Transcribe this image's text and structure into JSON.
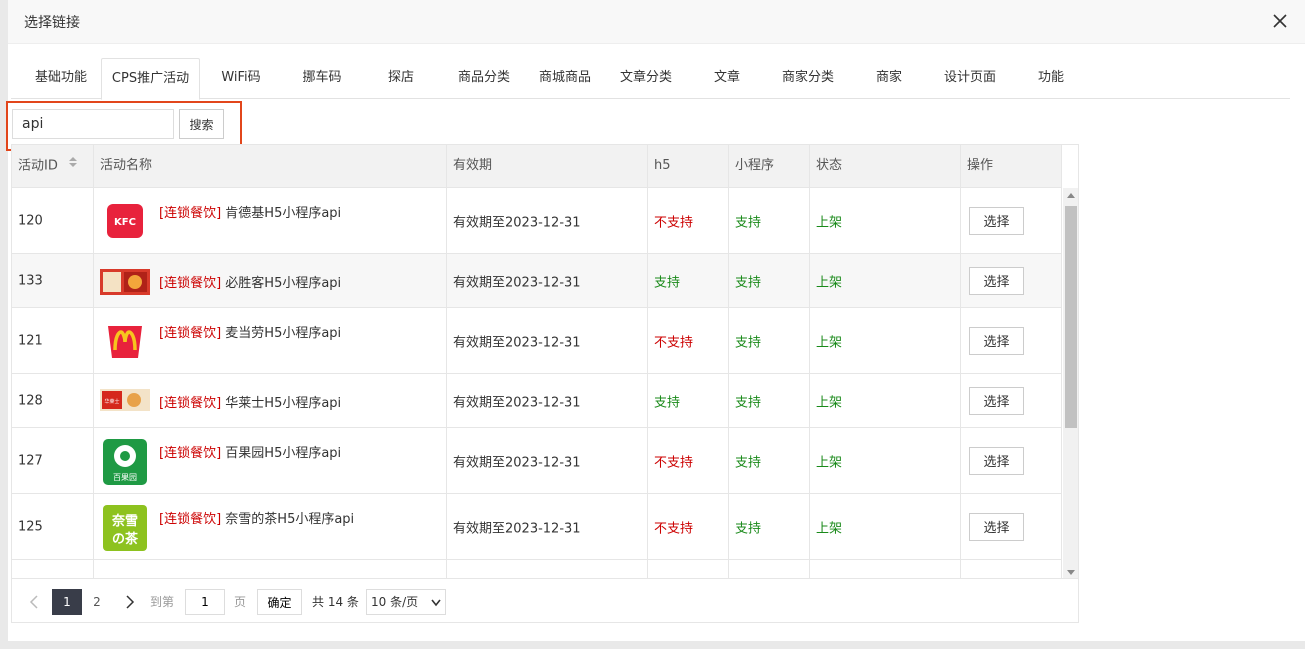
{
  "modal": {
    "title": "选择链接"
  },
  "tabs": [
    {
      "label": "基础功能"
    },
    {
      "label": "CPS推广活动"
    },
    {
      "label": "WiFi码"
    },
    {
      "label": "挪车码"
    },
    {
      "label": "探店"
    },
    {
      "label": "商品分类"
    },
    {
      "label": "商城商品"
    },
    {
      "label": "文章分类"
    },
    {
      "label": "文章"
    },
    {
      "label": "商家分类"
    },
    {
      "label": "商家"
    },
    {
      "label": "设计页面"
    },
    {
      "label": "功能"
    }
  ],
  "search": {
    "value": "api",
    "button_label": "搜索"
  },
  "table": {
    "headers": {
      "id": "活动ID",
      "name": "活动名称",
      "validity": "有效期",
      "h5": "h5",
      "mini": "小程序",
      "status": "状态",
      "action": "操作"
    },
    "rows": [
      {
        "id": "120",
        "category": "[连锁餐饮]",
        "name": " 肯德基H5小程序api",
        "validity": "有效期至2023-12-31",
        "h5": "不支持",
        "mini": "支持",
        "status": "上架",
        "action": "选择",
        "logo": "kfc-logo"
      },
      {
        "id": "133",
        "category": "[连锁餐饮]",
        "name": " 必胜客H5小程序api",
        "validity": "有效期至2023-12-31",
        "h5": "支持",
        "mini": "支持",
        "status": "上架",
        "action": "选择",
        "logo": "pizzahut-logo"
      },
      {
        "id": "121",
        "category": "[连锁餐饮]",
        "name": " 麦当劳H5小程序api",
        "validity": "有效期至2023-12-31",
        "h5": "不支持",
        "mini": "支持",
        "status": "上架",
        "action": "选择",
        "logo": "mcdonalds-logo"
      },
      {
        "id": "128",
        "category": "[连锁餐饮]",
        "name": " 华莱士H5小程序api",
        "validity": "有效期至2023-12-31",
        "h5": "支持",
        "mini": "支持",
        "status": "上架",
        "action": "选择",
        "logo": "wallace-logo"
      },
      {
        "id": "127",
        "category": "[连锁餐饮]",
        "name": " 百果园H5小程序api",
        "validity": "有效期至2023-12-31",
        "h5": "不支持",
        "mini": "支持",
        "status": "上架",
        "action": "选择",
        "logo": "pagoda-logo"
      },
      {
        "id": "125",
        "category": "[连锁餐饮]",
        "name": " 奈雪的茶H5小程序api",
        "validity": "有效期至2023-12-31",
        "h5": "不支持",
        "mini": "支持",
        "status": "上架",
        "action": "选择",
        "logo": "naixue-logo"
      }
    ]
  },
  "logos": {
    "kfc": "KFC",
    "pagoda": "百果园",
    "naixue_top": "奈雪",
    "naixue_bottom": "の茶",
    "wallace": "华莱士"
  },
  "pagination": {
    "pages": [
      "1",
      "2"
    ],
    "current": "1",
    "goto_label": "到第",
    "goto_value": "1",
    "page_suffix": "页",
    "confirm_label": "确定",
    "total": "共 14 条",
    "per_page": "10 条/页"
  },
  "colors": {
    "accent_border": "#e2461b",
    "red_text": "#cc0000",
    "green_text": "#1a8a1a",
    "active_page": "#393d49"
  }
}
